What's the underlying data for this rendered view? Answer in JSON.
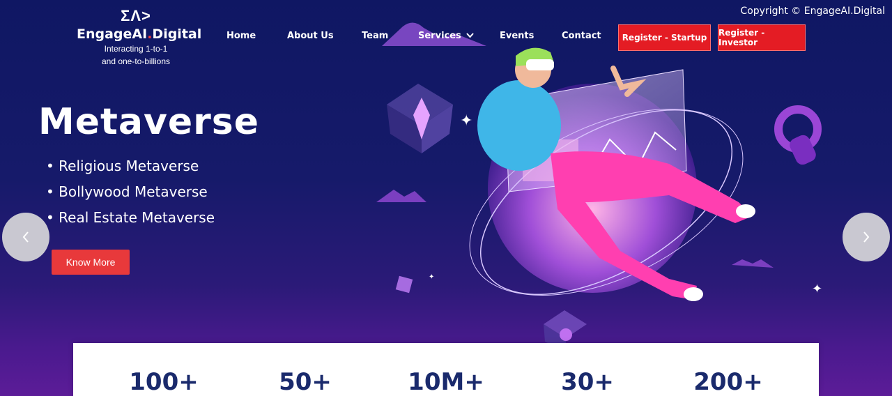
{
  "copyright": "Copyright © EngageAI.Digital",
  "logo": {
    "mark": "ΣΛ>",
    "name_main": "EngageAI",
    "name_dot": ".",
    "name_suffix": "Digital",
    "tagline_1": "Interacting 1-to-1",
    "tagline_2": "and one-to-billions"
  },
  "nav": {
    "home": "Home",
    "about": "About Us",
    "team": "Team",
    "services": "Services",
    "events": "Events",
    "contact": "Contact",
    "register_startup": "Register - Startup",
    "register_investor": "Register - Investor"
  },
  "hero": {
    "title": "Metaverse",
    "bullets": [
      "Religious Metaverse",
      "Bollywood Metaverse",
      "Real Estate Metaverse"
    ],
    "cta": "Know More"
  },
  "carousel": {
    "prev_icon": "chevron-left-icon",
    "next_icon": "chevron-right-icon"
  },
  "stats": [
    "100+",
    "50+",
    "10M+",
    "30+",
    "200+"
  ],
  "colors": {
    "accent_red": "#e41c24",
    "hero_bg": "#0f1763",
    "stat_text": "#1a2a6c"
  }
}
